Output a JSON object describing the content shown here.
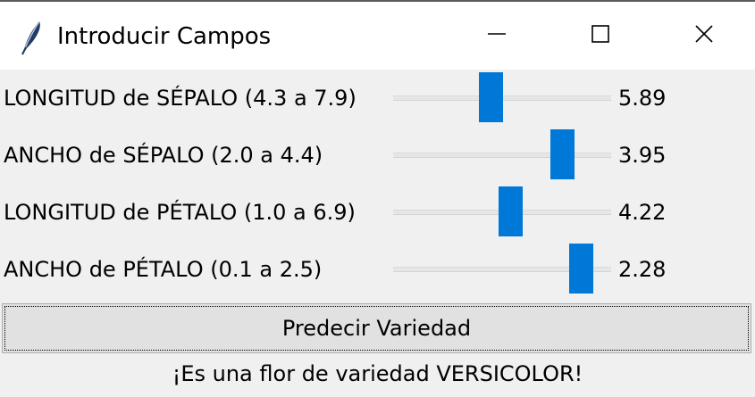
{
  "window": {
    "title": "Introducir Campos",
    "icon": "feather-icon",
    "controls": [
      "minimize-icon",
      "maximize-icon",
      "close-icon"
    ]
  },
  "sliders": [
    {
      "label": "LONGITUD de SÉPALO (4.3 a 7.9)",
      "min": 4.3,
      "max": 7.9,
      "value": "5.89"
    },
    {
      "label": "ANCHO de SÉPALO (2.0 a 4.4)",
      "min": 2.0,
      "max": 4.4,
      "value": "3.95"
    },
    {
      "label": "LONGITUD de PÉTALO (1.0 a 6.9)",
      "min": 1.0,
      "max": 6.9,
      "value": "4.22"
    },
    {
      "label": "ANCHO de PÉTALO (0.1 a 2.5)",
      "min": 0.1,
      "max": 2.5,
      "value": "2.28"
    }
  ],
  "predict_button": {
    "label": "Predecir Variedad"
  },
  "result": {
    "text": "¡Es una flor de variedad VERSICOLOR!"
  },
  "colors": {
    "slider_thumb": "#0078d7",
    "background": "#f0f0f0",
    "titlebar": "#ffffff"
  }
}
